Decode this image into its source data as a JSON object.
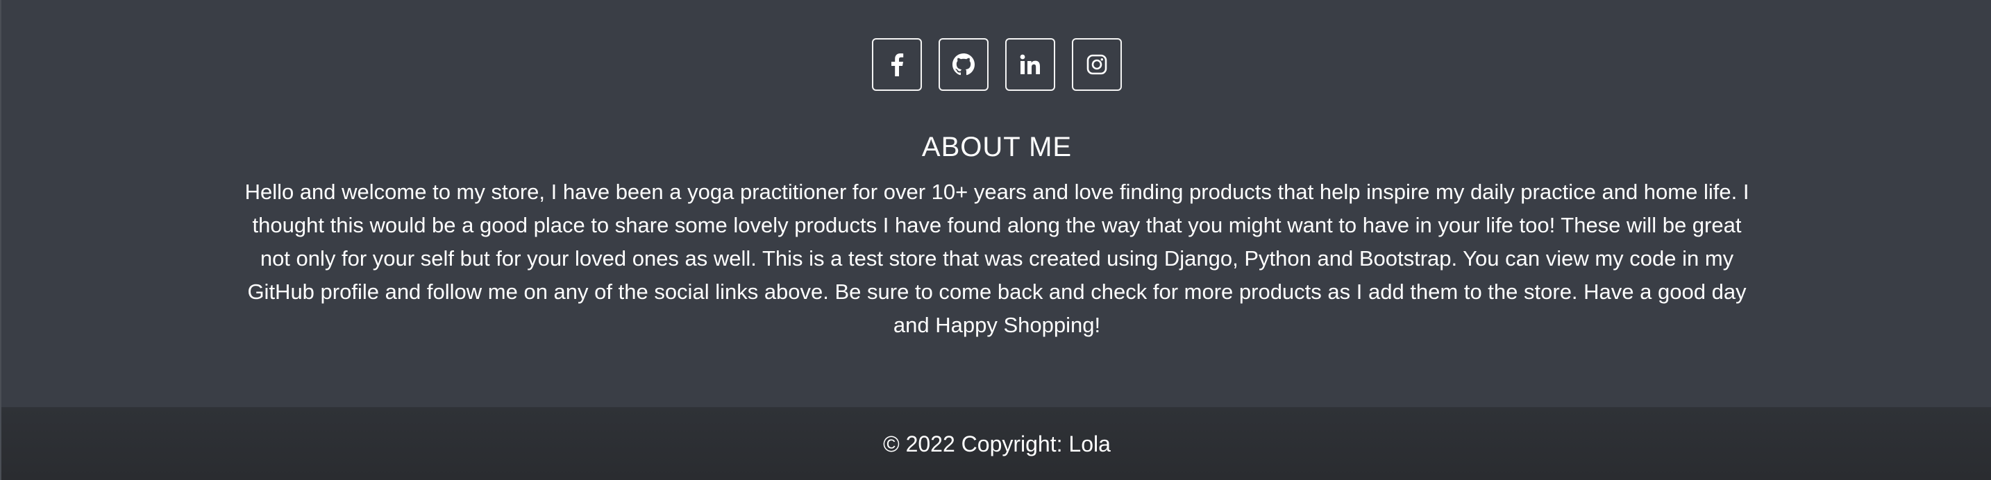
{
  "social": [
    {
      "name": "Facebook",
      "icon": "facebook-icon"
    },
    {
      "name": "GitHub",
      "icon": "github-icon"
    },
    {
      "name": "LinkedIn",
      "icon": "linkedin-icon"
    },
    {
      "name": "Instagram",
      "icon": "instagram-icon"
    }
  ],
  "about": {
    "title": "ABOUT ME",
    "text": "Hello and welcome to my store, I have been a yoga practitioner for over 10+ years and love finding products that help inspire my daily practice and home life. I thought this would be a good place to share some lovely products I have found along the way that you might want to have in your life too! These will be great not only for your self but for your loved ones as well. This is a test store that was created using Django, Python and Bootstrap. You can view my code in my GitHub profile and follow me on any of the social links above. Be sure to come back and check for more products as I add them to the store. Have a good day and Happy Shopping!"
  },
  "copyright": {
    "text": "© 2022 Copyright: Lola"
  },
  "colors": {
    "background": "#3a3e46",
    "copyright_bar": "#2c2e32",
    "text": "#ffffff"
  }
}
